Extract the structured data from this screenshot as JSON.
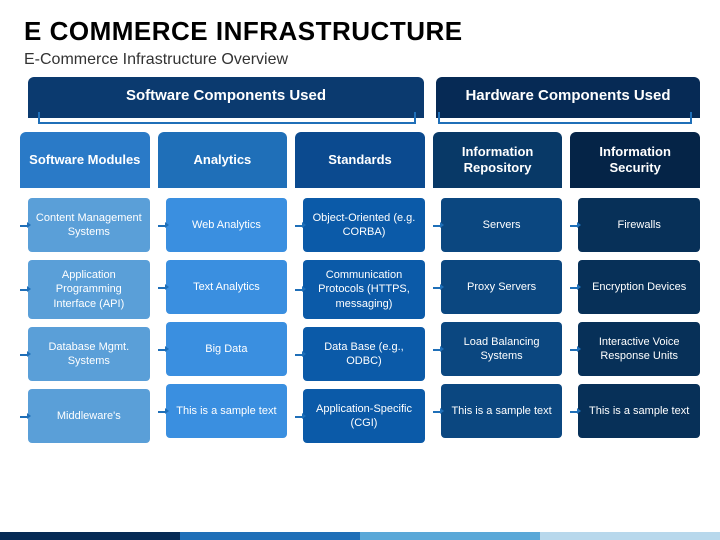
{
  "title": "E COMMERCE INFRASTRUCTURE",
  "subtitle": "E-Commerce Infrastructure Overview",
  "groups": {
    "software": "Software Components Used",
    "hardware": "Hardware Components Used"
  },
  "columns": [
    {
      "header": "Software Modules",
      "cells": [
        "Content Management Systems",
        "Application Programming Interface (API)",
        "Database Mgmt. Systems",
        "Middleware's"
      ]
    },
    {
      "header": "Analytics",
      "cells": [
        "Web Analytics",
        "Text Analytics",
        "Big Data",
        "This is a sample text"
      ]
    },
    {
      "header": "Standards",
      "cells": [
        "Object-Oriented (e.g. CORBA)",
        "Communication Protocols (HTTPS, messaging)",
        "Data Base (e.g., ODBC)",
        "Application-Specific (CGI)"
      ]
    },
    {
      "header": "Information Repository",
      "cells": [
        "Servers",
        "Proxy Servers",
        "Load Balancing Systems",
        "This is a sample text"
      ]
    },
    {
      "header": "Information Security",
      "cells": [
        "Firewalls",
        "Encryption Devices",
        "Interactive Voice Response Units",
        "This is a sample text"
      ]
    }
  ]
}
